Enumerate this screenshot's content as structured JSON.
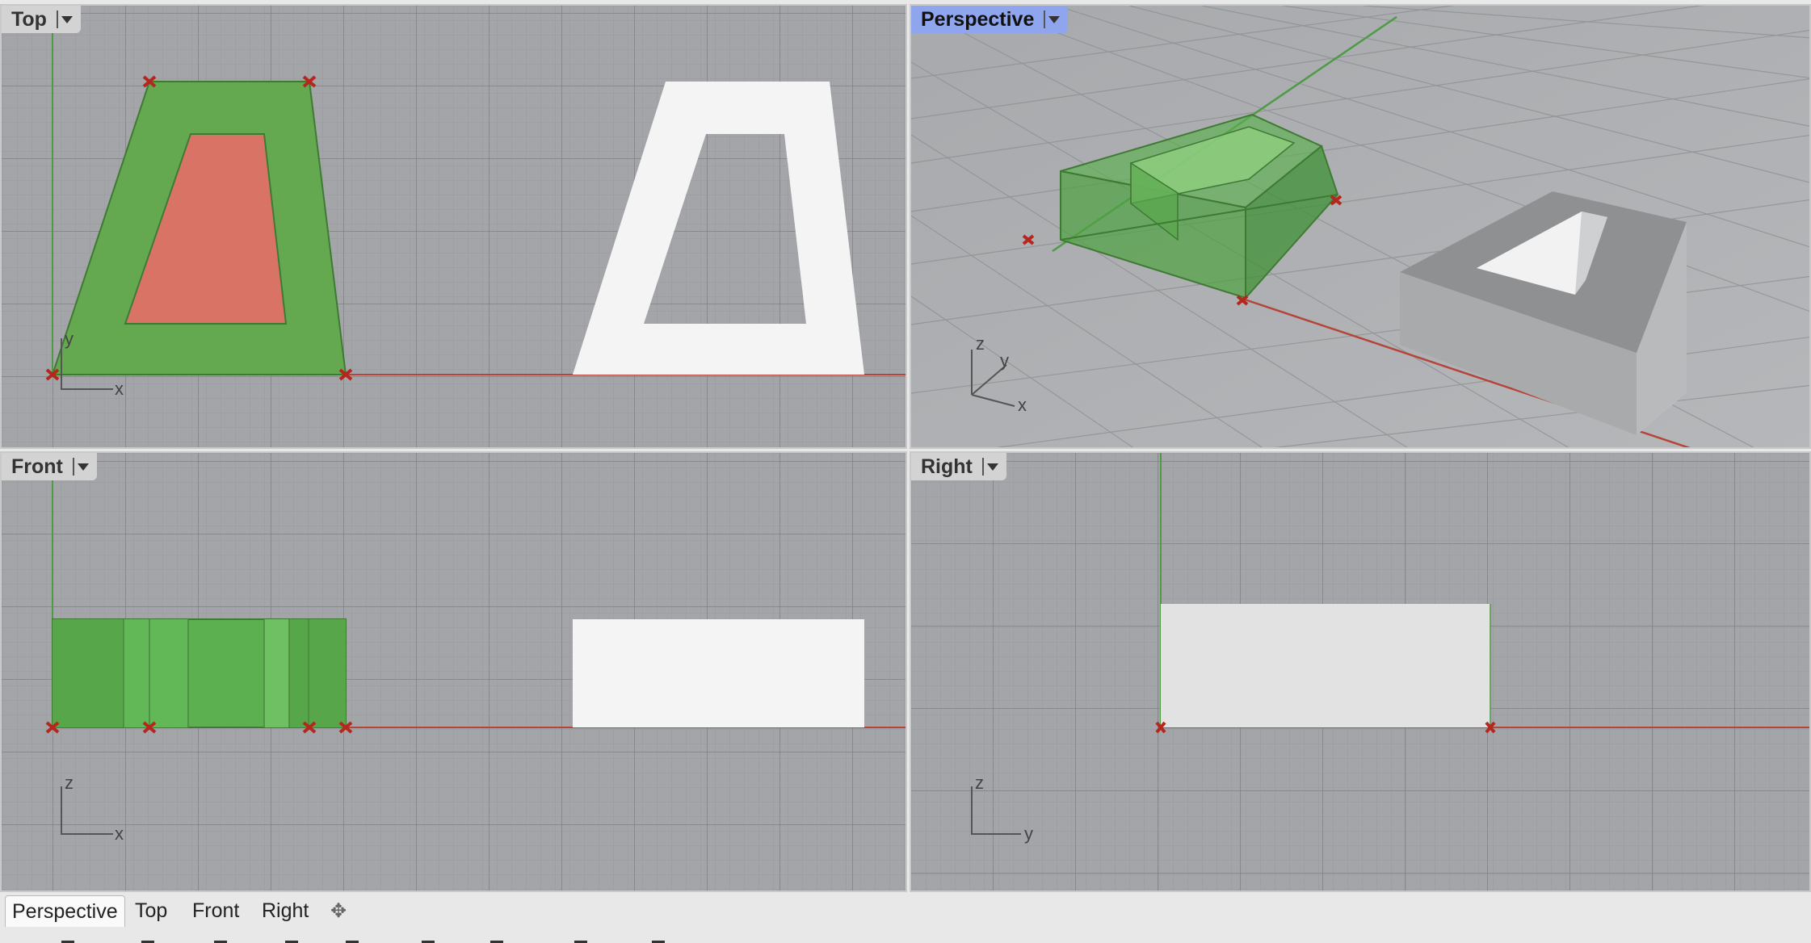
{
  "viewports": {
    "top": {
      "label": "Top",
      "axis_x": "x",
      "axis_y": "y"
    },
    "perspective": {
      "label": "Perspective",
      "axis_x": "x",
      "axis_y": "y",
      "axis_z": "z"
    },
    "front": {
      "label": "Front",
      "axis_x": "x",
      "axis_z": "z"
    },
    "right": {
      "label": "Right",
      "axis_y": "y",
      "axis_z": "z"
    }
  },
  "tabs": [
    {
      "label": "Perspective",
      "active": true
    },
    {
      "label": "Top",
      "active": false
    },
    {
      "label": "Front",
      "active": false
    },
    {
      "label": "Right",
      "active": false
    }
  ],
  "add_tab_icon": "plus-icon",
  "colors": {
    "viewport_bg": "#a3a5a8",
    "grid_minor": "#989a9d",
    "grid_major": "#7f8184",
    "x_axis": "#b5453a",
    "y_axis": "#4f9a45",
    "selected_green": "#5bb04f",
    "highlight_red": "#d97366",
    "white_solid": "#f4f4f4",
    "active_label": "#8fa6ee"
  }
}
